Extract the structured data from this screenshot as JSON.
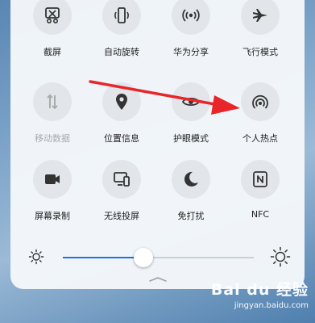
{
  "tiles": [
    {
      "label": "截屏",
      "icon": "scissors-screenshot-icon",
      "enabled": true
    },
    {
      "label": "自动旋转",
      "icon": "rotate-phone-icon",
      "enabled": true
    },
    {
      "label": "华为分享",
      "icon": "wireless-share-icon",
      "enabled": true
    },
    {
      "label": "飞行模式",
      "icon": "airplane-icon",
      "enabled": true
    },
    {
      "label": "移动数据",
      "icon": "mobile-data-icon",
      "enabled": false
    },
    {
      "label": "位置信息",
      "icon": "location-pin-icon",
      "enabled": true
    },
    {
      "label": "护眼模式",
      "icon": "eye-icon",
      "enabled": true
    },
    {
      "label": "个人热点",
      "icon": "hotspot-icon",
      "enabled": true
    },
    {
      "label": "屏幕录制",
      "icon": "video-camera-icon",
      "enabled": true
    },
    {
      "label": "无线投屏",
      "icon": "screen-cast-icon",
      "enabled": true
    },
    {
      "label": "免打扰",
      "icon": "moon-icon",
      "enabled": true
    },
    {
      "label": "NFC",
      "icon": "nfc-icon",
      "enabled": true
    }
  ],
  "brightness": {
    "level": 0.42,
    "min_icon": "sun-small-icon",
    "max_icon": "sun-large-icon"
  },
  "annotation": {
    "color": "#e8262a"
  },
  "watermark": {
    "brand": "Bai du 经验",
    "url": "jingyan.baidu.com"
  }
}
